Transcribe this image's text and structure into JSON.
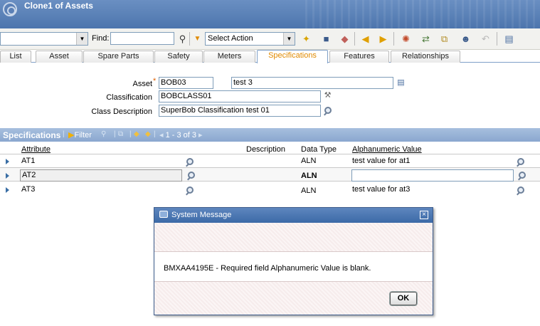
{
  "app": {
    "title": "Clone1 of Assets"
  },
  "toolbar": {
    "find_label": "Find:",
    "find_value": "",
    "action_select": "Select Action"
  },
  "tabs": [
    {
      "label": "List"
    },
    {
      "label": "Asset"
    },
    {
      "label": "Spare Parts"
    },
    {
      "label": "Safety"
    },
    {
      "label": "Meters"
    },
    {
      "label": "Specifications",
      "active": true
    },
    {
      "label": "Features"
    },
    {
      "label": "Relationships"
    }
  ],
  "form": {
    "asset_label": "Asset",
    "asset_value": "BOB03",
    "asset_desc": "test 3",
    "classification_label": "Classification",
    "classification_value": "BOBCLASS01",
    "class_desc_label": "Class Description",
    "class_desc_value": "SuperBob Classification test 01"
  },
  "specs": {
    "title": "Specifications",
    "filter": "Filter",
    "count": "1 - 3 of 3",
    "columns": {
      "attribute": "Attribute",
      "description": "Description",
      "datatype": "Data Type",
      "alnvalue": "Alphanumeric Value"
    },
    "rows": [
      {
        "attribute": "AT1",
        "datatype": "ALN",
        "value": "test value for at1"
      },
      {
        "attribute": "AT2",
        "datatype": "ALN",
        "value": ""
      },
      {
        "attribute": "AT3",
        "datatype": "ALN",
        "value": "test value for at3"
      }
    ]
  },
  "dialog": {
    "title": "System Message",
    "message": "BMXAA4195E - Required field Alphanumeric Value is blank.",
    "ok": "OK"
  }
}
